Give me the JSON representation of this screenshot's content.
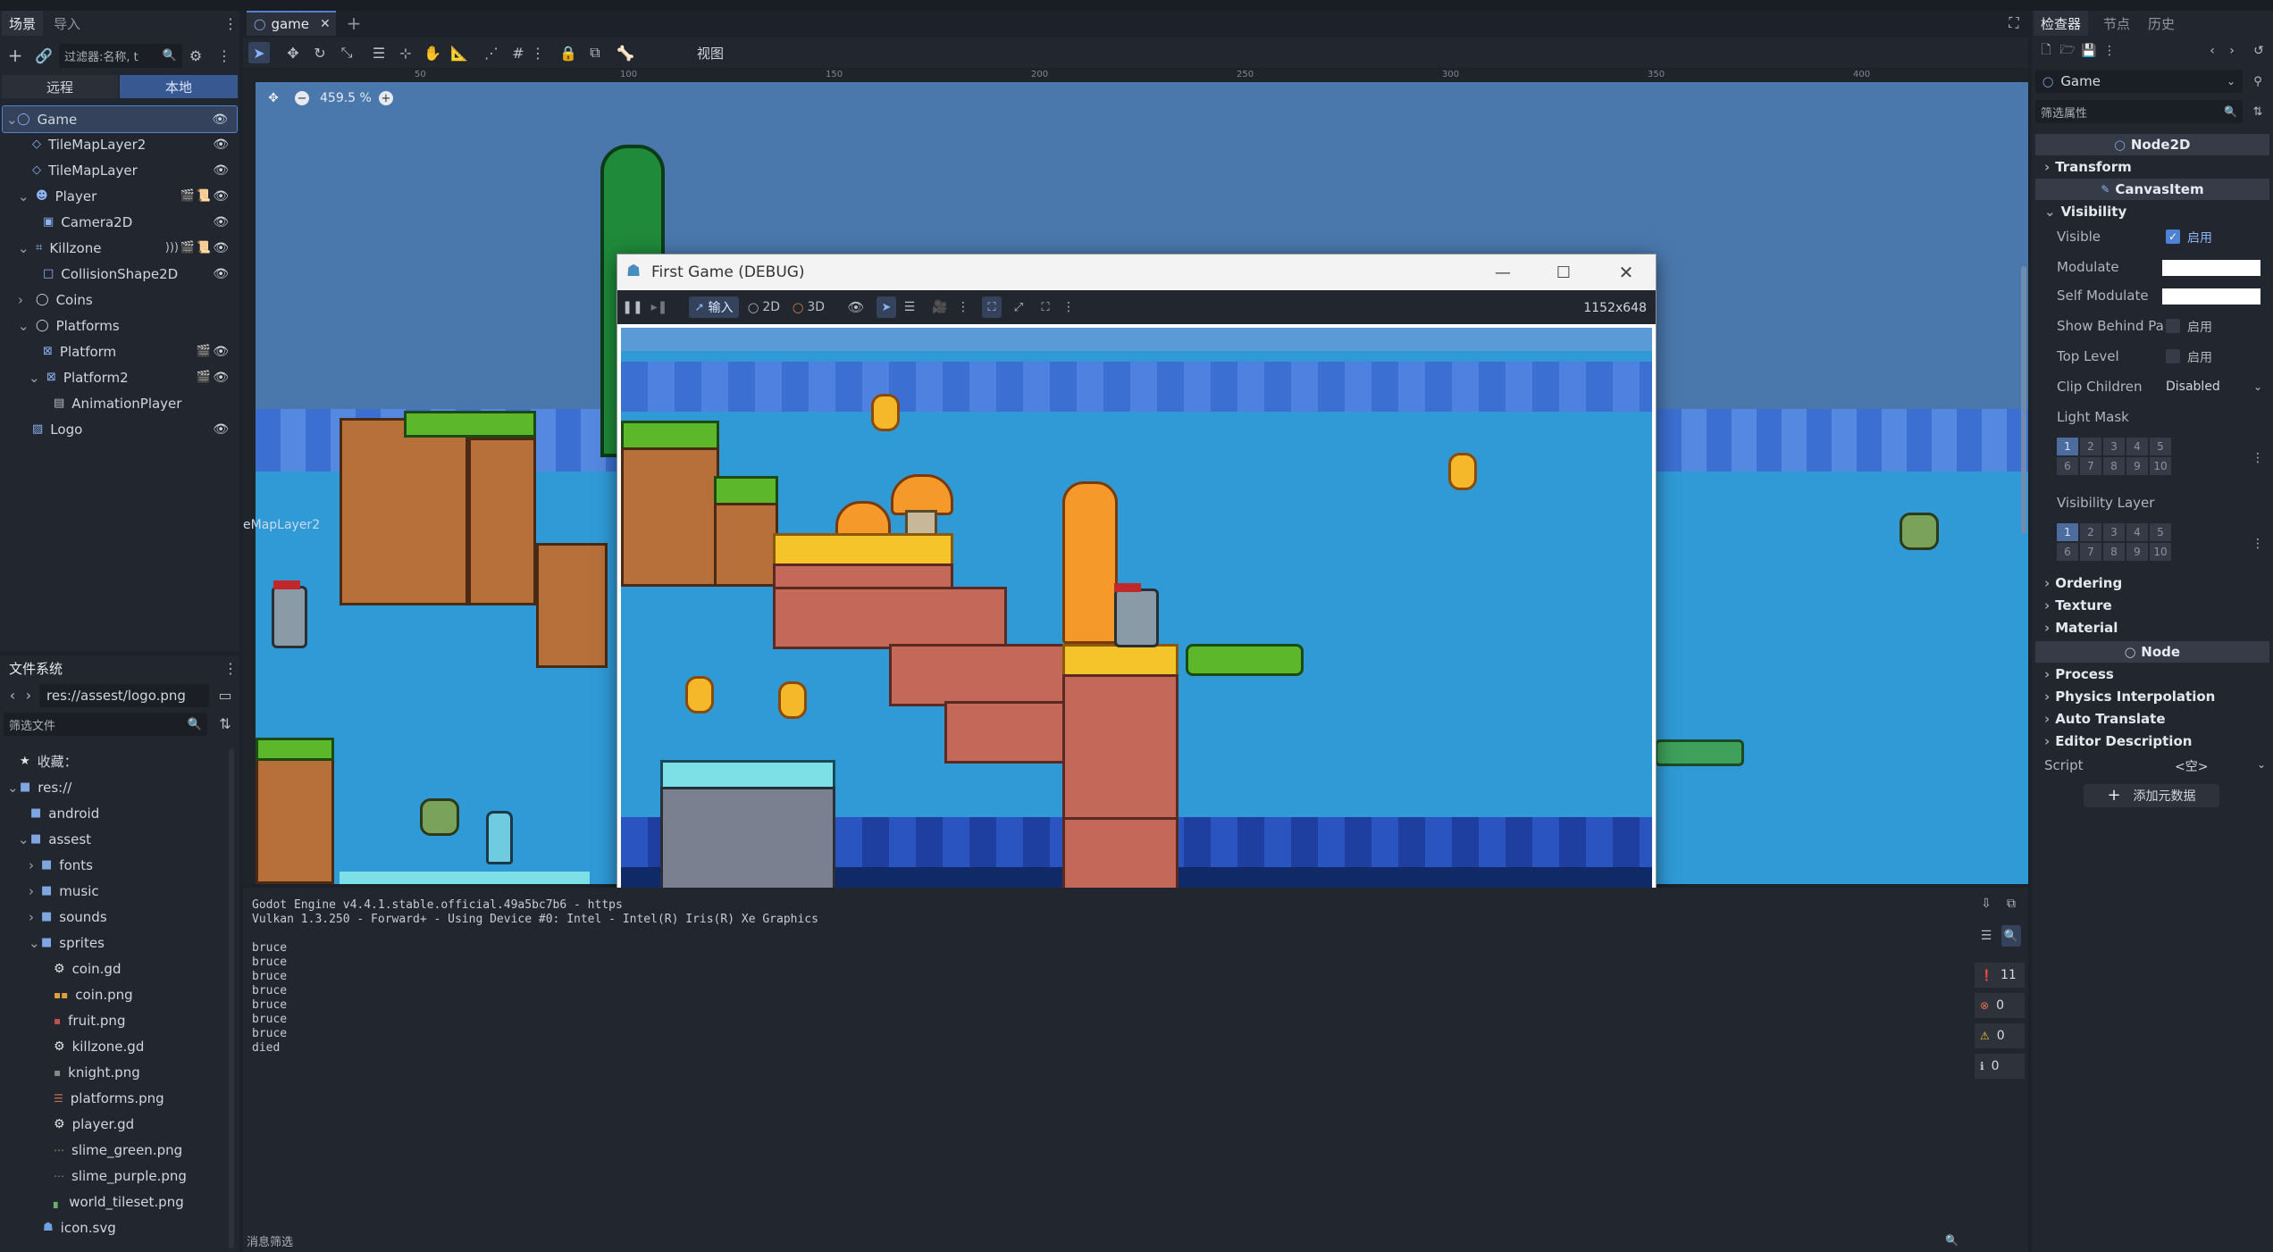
{
  "left_dock": {
    "tabs": [
      "场景",
      "导入"
    ],
    "filter_placeholder": "过滤器:名称, t",
    "subtabs": [
      "远程",
      "本地"
    ],
    "tree": [
      {
        "label": "Game",
        "depth": 0,
        "icon": "node2d-icon",
        "selected": true
      },
      {
        "label": "TileMapLayer2",
        "depth": 1,
        "icon": "tilemap-icon"
      },
      {
        "label": "TileMapLayer",
        "depth": 1,
        "icon": "tilemap-icon"
      },
      {
        "label": "Player",
        "depth": 1,
        "icon": "character-icon"
      },
      {
        "label": "Camera2D",
        "depth": 2,
        "icon": "camera-icon"
      },
      {
        "label": "Killzone",
        "depth": 1,
        "icon": "area-icon"
      },
      {
        "label": "CollisionShape2D",
        "depth": 2,
        "icon": "shape-icon"
      },
      {
        "label": "Coins",
        "depth": 1,
        "icon": "node2d-icon"
      },
      {
        "label": "Platforms",
        "depth": 1,
        "icon": "node2d-icon"
      },
      {
        "label": "Platform",
        "depth": 2,
        "icon": "body-icon"
      },
      {
        "label": "Platform2",
        "depth": 2,
        "icon": "body-icon"
      },
      {
        "label": "AnimationPlayer",
        "depth": 3,
        "icon": "animation-icon"
      },
      {
        "label": "Logo",
        "depth": 1,
        "icon": "sprite-icon"
      }
    ]
  },
  "filesystem": {
    "title": "文件系统",
    "path": "res://assest/logo.png",
    "filter_placeholder": "筛选文件",
    "items": [
      {
        "label": "收藏：",
        "depth": 0,
        "icon": "star-icon"
      },
      {
        "label": "res://",
        "depth": 0,
        "icon": "folder-icon"
      },
      {
        "label": "android",
        "depth": 1,
        "icon": "folder-icon"
      },
      {
        "label": "assest",
        "depth": 1,
        "icon": "folder-icon"
      },
      {
        "label": "fonts",
        "depth": 2,
        "icon": "folder-icon"
      },
      {
        "label": "music",
        "depth": 2,
        "icon": "folder-icon"
      },
      {
        "label": "sounds",
        "depth": 2,
        "icon": "folder-icon"
      },
      {
        "label": "sprites",
        "depth": 2,
        "icon": "folder-icon"
      },
      {
        "label": "coin.gd",
        "depth": 3,
        "icon": "gear-icon"
      },
      {
        "label": "coin.png",
        "depth": 3,
        "icon": "image-icon"
      },
      {
        "label": "fruit.png",
        "depth": 3,
        "icon": "image-icon"
      },
      {
        "label": "killzone.gd",
        "depth": 3,
        "icon": "gear-icon"
      },
      {
        "label": "knight.png",
        "depth": 3,
        "icon": "image-icon"
      },
      {
        "label": "platforms.png",
        "depth": 3,
        "icon": "image-icon"
      },
      {
        "label": "player.gd",
        "depth": 3,
        "icon": "gear-icon"
      },
      {
        "label": "slime_green.png",
        "depth": 3,
        "icon": "image-icon"
      },
      {
        "label": "slime_purple.png",
        "depth": 3,
        "icon": "image-icon"
      },
      {
        "label": "world_tileset.png",
        "depth": 3,
        "icon": "image-icon"
      },
      {
        "label": "icon.svg",
        "depth": 2,
        "icon": "godot-icon"
      }
    ]
  },
  "editor": {
    "tab_label": "game",
    "view_label": "视图",
    "zoom_label": "459.5 %",
    "ruler_labels": [
      "50",
      "100",
      "150",
      "200",
      "250",
      "300",
      "350",
      "400"
    ],
    "layer_label": "eMapLayer2"
  },
  "game_window": {
    "title": "First Game (DEBUG)",
    "input_label": "输入",
    "mode_2d": "2D",
    "mode_3d": "3D",
    "resolution": "1152x648"
  },
  "output": {
    "lines": [
      "Godot Engine v4.4.1.stable.official.49a5bc7b6 - https",
      "Vulkan 1.3.250 - Forward+ - Using Device #0: Intel - Intel(R) Iris(R) Xe Graphics",
      "",
      "bruce",
      "bruce",
      "bruce",
      "bruce",
      "bruce",
      "bruce",
      "bruce",
      "died"
    ],
    "filter_label": "消息筛选",
    "counts": [
      "11",
      "0",
      "0",
      "0"
    ]
  },
  "inspector": {
    "tabs": [
      "检查器",
      "节点",
      "历史"
    ],
    "node_select": "Game",
    "filter_placeholder": "筛选属性",
    "class_node2d": "Node2D",
    "class_canvasitem": "CanvasItem",
    "class_node": "Node",
    "sections_top": [
      "Transform"
    ],
    "visibility_title": "Visibility",
    "visible_label": "Visible",
    "enabled_label": "启用",
    "modulate_label": "Modulate",
    "self_modulate_label": "Self Modulate",
    "show_behind_label": "Show Behind Pa",
    "top_level_label": "Top Level",
    "clip_children_label": "Clip Children",
    "clip_children_value": "Disabled",
    "light_mask_label": "Light Mask",
    "visibility_layer_label": "Visibility Layer",
    "grid_numbers": [
      "1",
      "2",
      "3",
      "4",
      "5",
      "6",
      "7",
      "8",
      "9",
      "10"
    ],
    "sections_mid": [
      "Ordering",
      "Texture",
      "Material"
    ],
    "sections_bottom": [
      "Process",
      "Physics Interpolation",
      "Auto Translate",
      "Editor Description"
    ],
    "script_label": "Script",
    "script_value": "<空>",
    "add_metadata": "添加元数据"
  },
  "colors": {
    "accent": "#4d82d4",
    "panel": "#22262e",
    "sky": "#2f9ad6"
  }
}
